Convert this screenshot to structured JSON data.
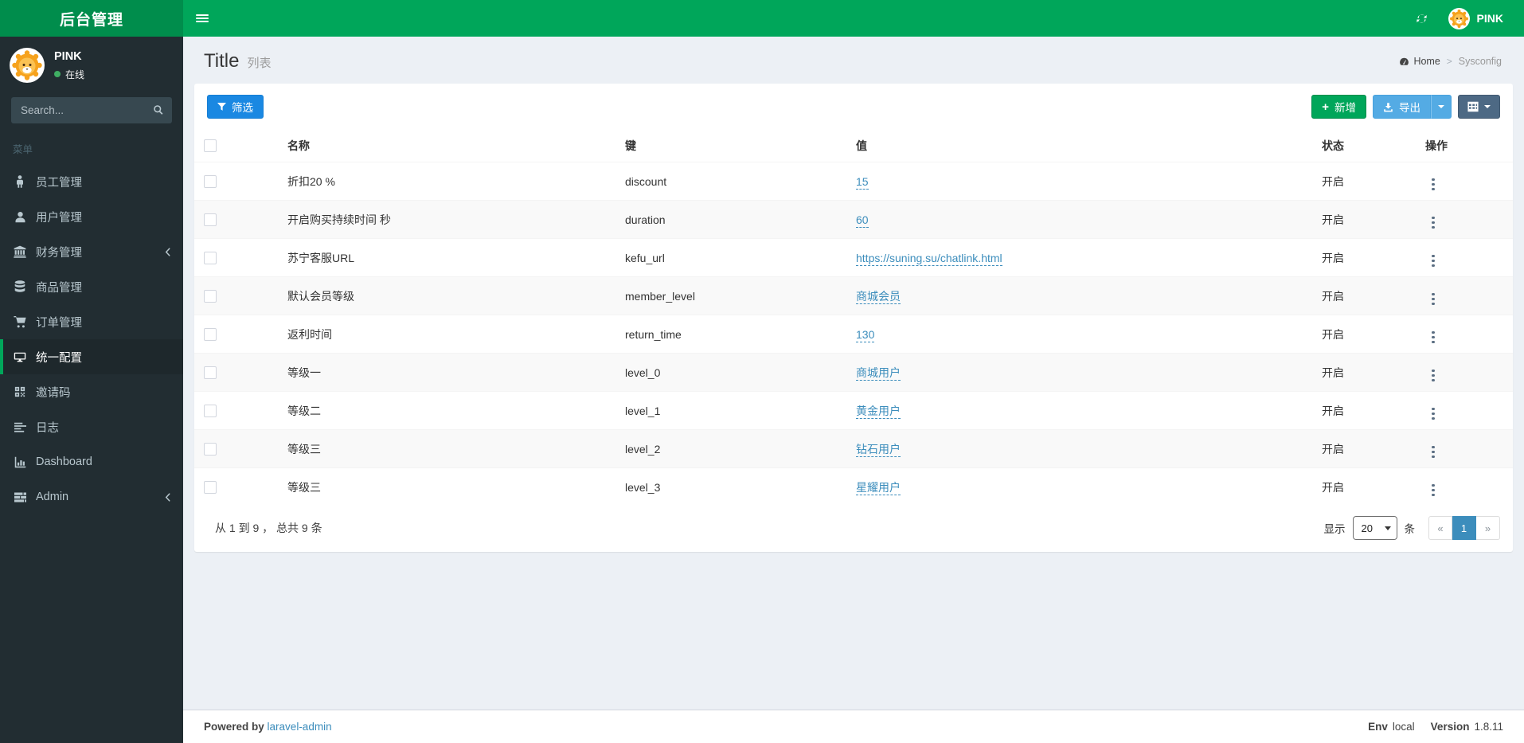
{
  "header": {
    "logo_text": "后台管理",
    "user_name": "PINK"
  },
  "sidebar": {
    "user": {
      "name": "PINK",
      "status": "在线"
    },
    "search_placeholder": "Search...",
    "section_label": "菜单",
    "items": [
      {
        "label": "员工管理",
        "icon": "male-icon",
        "active": false,
        "arrow": false
      },
      {
        "label": "用户管理",
        "icon": "user-icon",
        "active": false,
        "arrow": false
      },
      {
        "label": "财务管理",
        "icon": "bank-icon",
        "active": false,
        "arrow": true
      },
      {
        "label": "商品管理",
        "icon": "database-icon",
        "active": false,
        "arrow": false
      },
      {
        "label": "订单管理",
        "icon": "cart-icon",
        "active": false,
        "arrow": false
      },
      {
        "label": "统一配置",
        "icon": "desktop-icon",
        "active": true,
        "arrow": false
      },
      {
        "label": "邀请码",
        "icon": "qrcode-icon",
        "active": false,
        "arrow": false
      },
      {
        "label": "日志",
        "icon": "align-left-icon",
        "active": false,
        "arrow": false
      },
      {
        "label": "Dashboard",
        "icon": "bar-chart-icon",
        "active": false,
        "arrow": false
      },
      {
        "label": "Admin",
        "icon": "tasks-icon",
        "active": false,
        "arrow": true
      }
    ]
  },
  "content": {
    "title": "Title",
    "subtitle": "列表",
    "breadcrumb": {
      "home": "Home",
      "separator": ">",
      "current": "Sysconfig"
    },
    "toolbar": {
      "filter_label": "筛选",
      "add_label": "新增",
      "export_label": "导出"
    },
    "table": {
      "columns": [
        "名称",
        "键",
        "值",
        "状态",
        "操作"
      ],
      "rows": [
        {
          "name": "折扣20 %",
          "key": "discount",
          "value": "15",
          "status": "开启"
        },
        {
          "name": "开启购买持续时间 秒",
          "key": "duration",
          "value": "60",
          "status": "开启"
        },
        {
          "name": "苏宁客服URL",
          "key": "kefu_url",
          "value": "https://suning.su/chatlink.html",
          "status": "开启"
        },
        {
          "name": "默认会员等级",
          "key": "member_level",
          "value": "商城会员",
          "status": "开启"
        },
        {
          "name": "返利时间",
          "key": "return_time",
          "value": "130",
          "status": "开启"
        },
        {
          "name": "等级一",
          "key": "level_0",
          "value": "商城用户",
          "status": "开启"
        },
        {
          "name": "等级二",
          "key": "level_1",
          "value": "黄金用户",
          "status": "开启"
        },
        {
          "name": "等级三",
          "key": "level_2",
          "value": "钻石用户",
          "status": "开启"
        },
        {
          "name": "等级三",
          "key": "level_3",
          "value": "星耀用户",
          "status": "开启"
        }
      ]
    },
    "table_footer": {
      "summary": "从 1 到 9 ， 总共 9 条",
      "per_page_label_before": "显示",
      "per_page_value": "20",
      "per_page_label_after": "条",
      "pagination": {
        "prev": "«",
        "current": "1",
        "next": "»"
      }
    }
  },
  "footer": {
    "powered_by_label": "Powered by",
    "powered_by_link": "laravel-admin",
    "env_label": "Env",
    "env_value": "local",
    "version_label": "Version",
    "version_value": "1.8.11"
  },
  "colors": {
    "navbar_green": "#00a65a",
    "logo_green": "#008d4c",
    "sidebar_bg": "#222d32",
    "sidebar_active_marker": "#00a65a",
    "content_bg": "#ecf0f5",
    "link_blue": "#3c8dbc",
    "filter_button_blue": "#1a88e2",
    "add_button_green": "#00a65a",
    "export_button_blue": "#54abe4",
    "grid_button_slate": "#4d6984",
    "pagination_active_blue": "#3c8dbc"
  }
}
